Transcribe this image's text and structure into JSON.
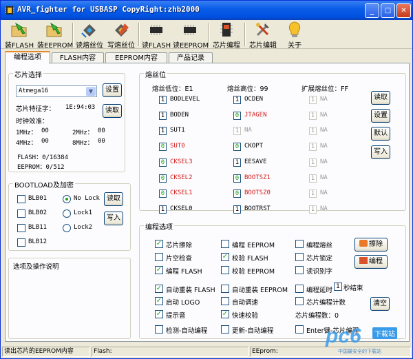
{
  "window": {
    "title": "AVR_fighter for USBASP CopyRight:zhb2000",
    "min": "_",
    "max": "□",
    "close": "✕"
  },
  "toolbar": [
    {
      "label": "装FLASH",
      "icon": "folder-green-arrow-icon"
    },
    {
      "label": "装EEPROM",
      "icon": "folder-green-arrow-icon"
    },
    {
      "label": "读熔丝位",
      "icon": "read-fuse-icon"
    },
    {
      "label": "写熔丝位",
      "icon": "write-fuse-icon"
    },
    {
      "label": "读FLASH",
      "icon": "chip-icon"
    },
    {
      "label": "读EEPROM",
      "icon": "chip-icon"
    },
    {
      "label": "芯片编程",
      "icon": "chip-program-icon"
    },
    {
      "label": "芯片编辑",
      "icon": "tools-icon"
    },
    {
      "label": "关于",
      "icon": "about-icon"
    }
  ],
  "tabs": [
    "编程选项",
    "FLASH内容",
    "EEPROM内容",
    "产品记录"
  ],
  "chip": {
    "group": "芯片选择",
    "selected": "Atmega16",
    "set_btn": "设置",
    "read_btn": "读取",
    "sig_label": "芯片特征字：",
    "sig_value": "1E:94:03",
    "clock_label": "时钟效准：",
    "clocks": [
      {
        "l": "1MHz：",
        "v": "00"
      },
      {
        "l": "2MHz：",
        "v": "00"
      },
      {
        "l": "4MHz：",
        "v": "00"
      },
      {
        "l": "8MHz：",
        "v": "00"
      }
    ],
    "flash": "FLASH：0/16384",
    "eeprom": "EEPROM：0/512"
  },
  "boot": {
    "group": "BOOTLOAD及加密",
    "chks": [
      "BLB01",
      "BLB02",
      "BLB11",
      "BLB12"
    ],
    "radios": [
      {
        "label": "No Lock",
        "on": true
      },
      {
        "label": "Lock1",
        "on": false
      },
      {
        "label": "Lock2",
        "on": false
      }
    ],
    "read_btn": "读取",
    "write_btn": "写入"
  },
  "desc": {
    "group": "选项及操作说明"
  },
  "fuse": {
    "group": "熔丝位",
    "low_label": "熔丝低位：E1",
    "high_label": "熔丝高位：99",
    "ext_label": "扩展熔丝位：FF",
    "low": [
      {
        "v": "1",
        "n": "BODLEVEL",
        "c": "n"
      },
      {
        "v": "1",
        "n": "BODEN",
        "c": "n"
      },
      {
        "v": "1",
        "n": "SUT1",
        "c": "n"
      },
      {
        "v": "0",
        "n": "SUT0",
        "c": "r"
      },
      {
        "v": "0",
        "n": "CKSEL3",
        "c": "r"
      },
      {
        "v": "0",
        "n": "CKSEL2",
        "c": "r"
      },
      {
        "v": "0",
        "n": "CKSEL1",
        "c": "r"
      },
      {
        "v": "1",
        "n": "CKSEL0",
        "c": "n"
      }
    ],
    "high": [
      {
        "v": "1",
        "n": "OCDEN",
        "c": "n"
      },
      {
        "v": "0",
        "n": "JTAGEN",
        "c": "r"
      },
      {
        "v": "1",
        "n": "NA",
        "c": "g"
      },
      {
        "v": "0",
        "n": "CKOPT",
        "c": "n"
      },
      {
        "v": "1",
        "n": "EESAVE",
        "c": "n"
      },
      {
        "v": "0",
        "n": "BOOTSZ1",
        "c": "r"
      },
      {
        "v": "0",
        "n": "BOOTSZ0",
        "c": "r"
      },
      {
        "v": "1",
        "n": "BOOTRST",
        "c": "n"
      }
    ],
    "ext": [
      "NA",
      "NA",
      "NA",
      "NA",
      "NA",
      "NA",
      "NA",
      "NA"
    ],
    "ext_val": "1",
    "btns": [
      "读取",
      "设置",
      "默认",
      "写入"
    ]
  },
  "prog": {
    "group": "编程选项",
    "col1": [
      {
        "label": "芯片擦除",
        "checked": true
      },
      {
        "label": "片空检查",
        "checked": false
      },
      {
        "label": "编程 FLASH",
        "checked": true
      },
      {
        "label": "自动重装 FLASH",
        "checked": true
      },
      {
        "label": "启动 LOGO",
        "checked": true
      },
      {
        "label": "提示音",
        "checked": true
      },
      {
        "label": "检测-自动编程",
        "checked": false
      }
    ],
    "col2": [
      {
        "label": "编程 EEPROM",
        "checked": false
      },
      {
        "label": "校验 FLASH",
        "checked": true
      },
      {
        "label": "校验 EEPROM",
        "checked": false
      },
      {
        "label": "自动重装 EEPROM",
        "checked": false
      },
      {
        "label": "自动调速",
        "checked": false
      },
      {
        "label": "快速校验",
        "checked": true
      },
      {
        "label": "更新-自动编程",
        "checked": false
      }
    ],
    "col3": [
      {
        "label": "编程熔丝",
        "checked": false
      },
      {
        "label": "芯片锁定",
        "checked": false
      },
      {
        "label": "读识别字",
        "checked": false
      },
      {
        "label": "编程延时",
        "checked": false
      },
      {
        "label": "芯片编程计数",
        "checked": false
      },
      {
        "label": "芯片编程数：0",
        "checked": null
      },
      {
        "label": "Enter键-芯片编程",
        "checked": false
      }
    ],
    "delay_value": "1",
    "delay_unit": "秒结束",
    "erase_btn": "擦除",
    "prog_btn": "编程",
    "clear_btn": "清空"
  },
  "status": {
    "msg": "读出芯片的EEPROM内容",
    "flash": "Flash:",
    "eeprom": "EEprom:"
  },
  "watermark": {
    "brand": "pc6",
    "sub": "下载站",
    "slogan": "中国最安全的下载站"
  }
}
